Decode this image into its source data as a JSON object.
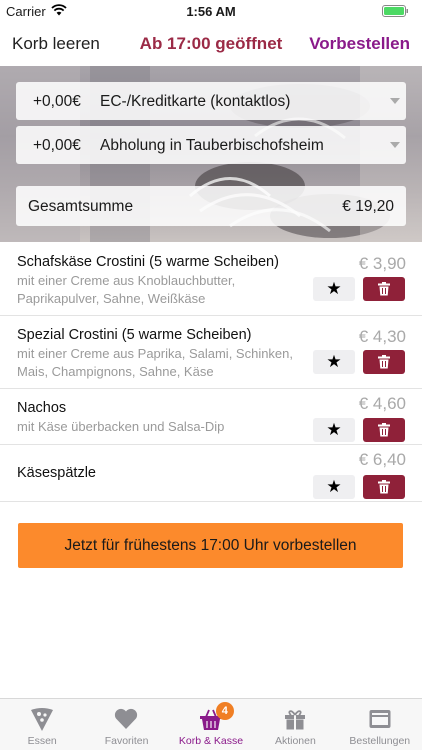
{
  "status_bar": {
    "carrier": "Carrier",
    "time": "1:56 AM"
  },
  "nav": {
    "left_label": "Korb leeren",
    "title": "Ab 17:00 geöffnet",
    "right_label": "Vorbestellen"
  },
  "payment": {
    "price": "+0,00€",
    "label": "EC-/Kreditkarte (kontaktlos)"
  },
  "delivery": {
    "price": "+0,00€",
    "label": "Abholung in Tauberbischofsheim"
  },
  "total": {
    "label": "Gesamtsumme",
    "value": "€ 19,20"
  },
  "items": [
    {
      "title": "Schafskäse Crostini (5 warme Scheiben)",
      "desc": "mit einer Creme aus Knoblauchbutter, Paprikapulver, Sahne, Weißkäse",
      "price": "€ 3,90",
      "fav": "★"
    },
    {
      "title": "Spezial Crostini (5 warme Scheiben)",
      "desc": "mit einer Creme aus Paprika, Salami, Schinken, Mais, Champignons, Sahne, Käse",
      "price": "€ 4,30",
      "fav": "★"
    },
    {
      "title": "Nachos",
      "desc": "mit Käse überbacken und Salsa-Dip",
      "price": "€ 4,60",
      "fav": "★"
    },
    {
      "title": "Käsespätzle",
      "desc": "",
      "price": "€ 6,40",
      "fav": "★"
    }
  ],
  "order_button": {
    "label": "Jetzt für frühestens 17:00 Uhr vorbestellen"
  },
  "tabs": [
    {
      "label": "Essen",
      "icon": "pizza-icon"
    },
    {
      "label": "Favoriten",
      "icon": "heart-icon"
    },
    {
      "label": "Korb & Kasse",
      "icon": "basket-icon",
      "badge": "4",
      "active": true
    },
    {
      "label": "Aktionen",
      "icon": "gift-icon"
    },
    {
      "label": "Bestellungen",
      "icon": "orders-icon"
    }
  ],
  "colors": {
    "title": "#9b2a46",
    "accent": "#8a1a8a",
    "delete": "#8f2139",
    "order": "#fc8a2c",
    "badge": "#f07f24"
  }
}
